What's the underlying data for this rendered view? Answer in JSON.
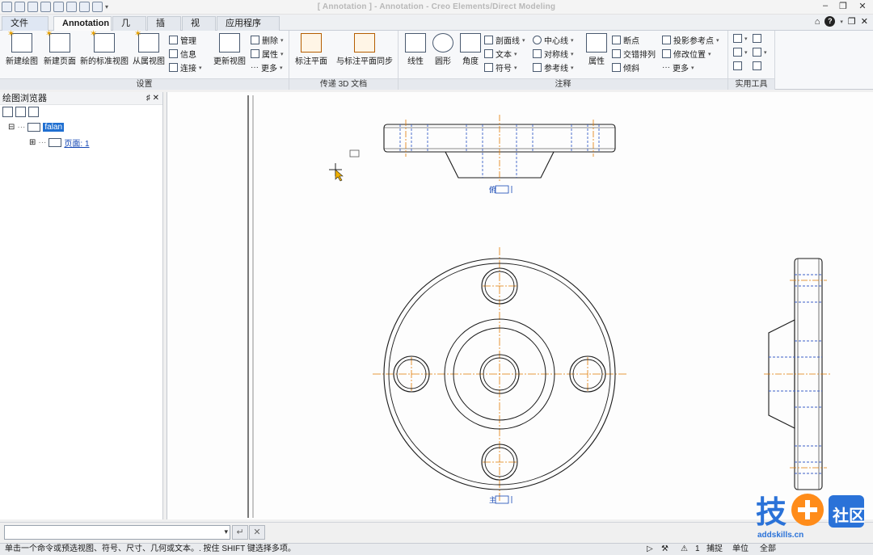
{
  "window": {
    "title": "[ Annotation ] - Annotation - Creo Elements/Direct Modeling",
    "quick_access_more": "▾"
  },
  "tabs": [
    {
      "label": "文件(F)"
    },
    {
      "label": "Annotation"
    },
    {
      "label": "几何"
    },
    {
      "label": "插入"
    },
    {
      "label": "视图"
    },
    {
      "label": "应用程序(A)"
    }
  ],
  "ribbon": {
    "setup": {
      "caption": "设置",
      "new_drawing": "新建绘图",
      "new_page": "新建页面",
      "new_std_view": "新的标准视图",
      "from_view": "从属视图",
      "manage": "管理",
      "info": "信息",
      "connect": "连接",
      "update_view": "更新视图",
      "delete": "删除",
      "properties": "属性",
      "more": "更多"
    },
    "transfer": {
      "caption": "传递 3D 文档",
      "annotate_plane": "标注平面",
      "sync_plane": "与标注平面同步"
    },
    "annotation": {
      "caption": "注释",
      "linear": "线性",
      "circular": "圆形",
      "angle": "角度",
      "section_line": "剖面线",
      "text": "文本",
      "symbol": "符号",
      "center_line": "中心线",
      "symmetry_line": "对称线",
      "reference_line": "参考线",
      "attributes": "属性",
      "break_point": "断点",
      "cross_arrange": "交错排列",
      "slant": "倾斜",
      "proj_ref_point": "投影参考点",
      "modify_pos": "修改位置",
      "more": "更多"
    },
    "utilities": {
      "caption": "实用工具"
    }
  },
  "browser": {
    "title": "绘图浏览器",
    "pin": "♯ ✕",
    "root_node": "falan",
    "page_node": "页面: 1"
  },
  "drawing": {
    "top_view_label": "俯",
    "front_view_label": "主",
    "accent_color": "#e07a00",
    "hidden_color": "#3a5fc8",
    "edge_color": "#1a1a1a"
  },
  "command": {
    "input_value": ""
  },
  "status": {
    "message": "单击一个命令或预选视图、符号、尺寸、几何或文本。. 按住 SHIFT 键选择多项。",
    "count": "1",
    "snap": "捕捉",
    "unit": "单位",
    "all": "全部"
  },
  "watermark": {
    "brand": "技",
    "community": "社区",
    "site": "addskills.cn"
  }
}
